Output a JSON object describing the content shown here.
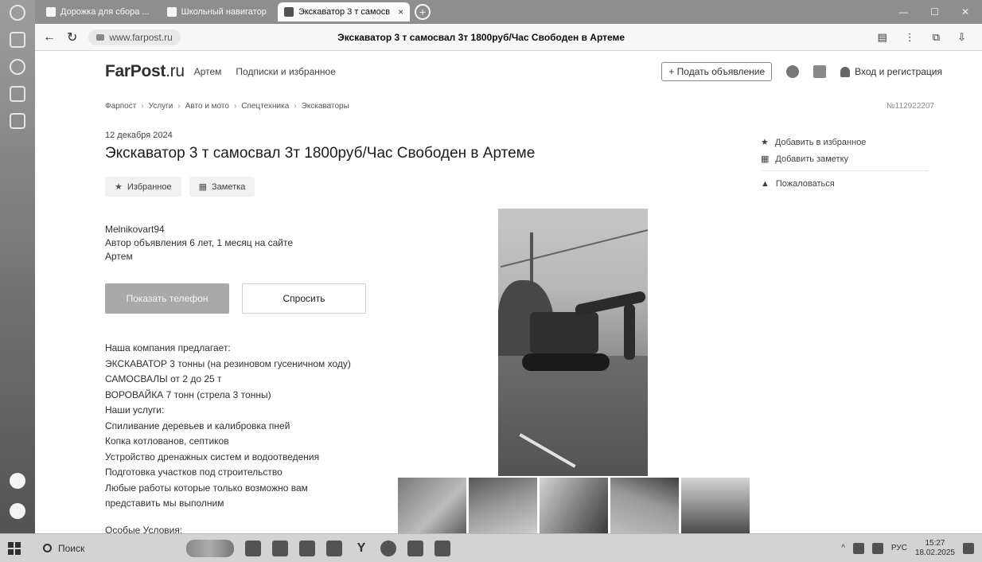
{
  "browser": {
    "tabs": [
      {
        "label": "Дорожка для сбора ...",
        "active": false
      },
      {
        "label": "Школьный навигатор",
        "active": false
      },
      {
        "label": "Экскаватор 3 т самосв",
        "active": true
      }
    ],
    "url": "www.farpost.ru",
    "page_title": "Экскаватор 3 т самосвал 3т 1800руб/Час Свободен в Артеме"
  },
  "header": {
    "logo": "FarPost",
    "logo_suffix": ".ru",
    "city": "Артем",
    "subscriptions": "Подписки и избранное",
    "post_button": "+ Подать объявление",
    "login": "Вход и регистрация"
  },
  "breadcrumb": {
    "items": [
      "Фарпост",
      "Услуги",
      "Авто и мото",
      "Спецтехника",
      "Экскаваторы"
    ],
    "ad_number": "№112922207"
  },
  "ad": {
    "date": "12 декабря 2024",
    "title": "Экскаватор 3 т самосвал 3т 1800руб/Час Свободен в Артеме",
    "favorite_label": "Избранное",
    "note_label": "Заметка"
  },
  "sidebar": {
    "add_favorite": "Добавить в избранное",
    "add_note": "Добавить заметку",
    "complain": "Пожаловаться"
  },
  "seller": {
    "name": "Melnikovart94",
    "tenure": "Автор объявления 6 лет, 1 месяц на сайте",
    "city": "Артем"
  },
  "buttons": {
    "show_phone": "Показать телефон",
    "ask": "Спросить"
  },
  "description": {
    "lines": [
      "Наша компания предлагает:",
      "ЭКСКАВАТОР 3 тонны (на резиновом гусеничном ходу)",
      "САМОСВАЛЫ от 2 до 25 т",
      "ВОРОВАЙКА 7 тонн (стрела 3 тонны)",
      "Наши услуги:",
      "Спиливание деревьев и калибровка пней",
      "Копка котлованов, септиков",
      "Устройство дренажных систем и водоотведения",
      "Подготовка участков под строительство",
      "Любые работы которые только возможно вам",
      "представить мы выполним"
    ],
    "conditions_heading": "Особые Условия:"
  },
  "taskbar": {
    "search_label": "Поиск",
    "lang": "РУС",
    "time": "15:27",
    "date": "18.02.2025"
  }
}
